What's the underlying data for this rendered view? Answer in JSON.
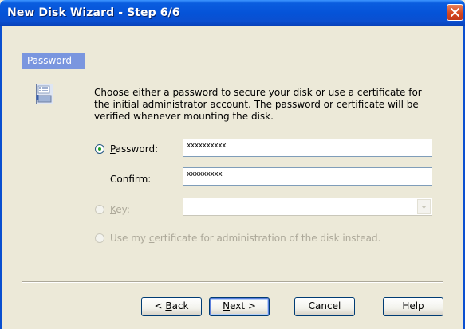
{
  "window": {
    "title": "New Disk Wizard - Step 6/6"
  },
  "section": {
    "title": "Password"
  },
  "description": "Choose either a password to secure your disk or use a certificate for the initial administrator account. The password or certificate will be verified whenever mounting the disk.",
  "options": {
    "password": {
      "label_prefix": "",
      "label_accel": "P",
      "label_rest": "assword:",
      "selected": true,
      "value": "xxxxxxxxxx"
    },
    "confirm": {
      "label": "Confirm:",
      "value": "xxxxxxxxx"
    },
    "key": {
      "label_accel": "K",
      "label_rest": "ey:",
      "selected": false,
      "enabled": false,
      "value": ""
    },
    "certificate": {
      "label_prefix": "Use my ",
      "label_accel": "c",
      "label_rest": "ertificate for administration of the disk instead.",
      "selected": false,
      "enabled": false
    }
  },
  "buttons": {
    "back": {
      "prefix": "< ",
      "accel": "B",
      "rest": "ack"
    },
    "next": {
      "accel": "N",
      "rest": "ext >"
    },
    "cancel": "Cancel",
    "help": "Help"
  },
  "icons": {
    "close": "close-icon",
    "disk": "disk-icon"
  },
  "colors": {
    "title_bar": "#0553d8",
    "close_button": "#d4461f",
    "section_tab": "#7a96df",
    "radio_dot": "#21a121",
    "dialog_bg": "#ece9d8"
  }
}
